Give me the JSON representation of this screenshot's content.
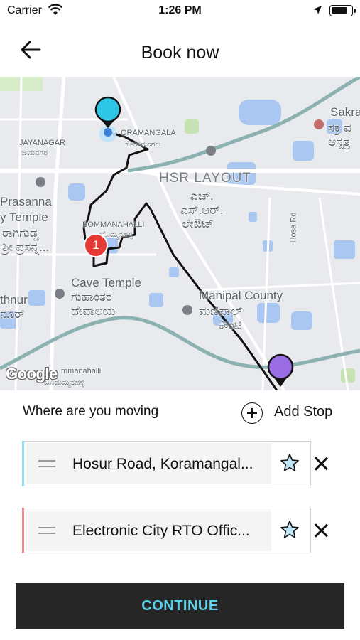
{
  "status_bar": {
    "carrier": "Carrier",
    "time": "1:26 PM"
  },
  "header": {
    "title": "Book now"
  },
  "map": {
    "labels": {
      "sakra": "Sakra",
      "sakra_kn1": "ಸಕ್ರ ವ",
      "sakra_kn2": "ಆಸ್ಪತ್ರ",
      "jayanagar": "JAYANAGAR",
      "jayanagar_kn": "ಜಯನಗರ",
      "koramangala": "ORAMANGALA",
      "koramangala_kn": "ಕೋರಮಂಗಲ",
      "hsr": "HSR LAYOUT",
      "hsr_kn1": "ಎಚ್.",
      "hsr_kn2": "ಎಸ್.ಆರ್.",
      "hsr_kn3": "ಲೇಔಟ್",
      "prasanna": "Prasanna",
      "temple": "y Temple",
      "temple_kn1": "ರಾಗಿಗುಡ್ಡ",
      "temple_kn2": "ಶ್ರೀ ಪ್ರಸನ್ನ...",
      "bommanahalli": "BOMMANAHALLI",
      "bommanahalli_kn": "ಬೊಮ್ಮನಹಳ್ಳಿ",
      "cave": "Cave Temple",
      "cave_kn1": "ಗುಹಾಂತರ",
      "cave_kn2": "ದೇವಾಲಯ",
      "hosa_rd": "Hosa Rd",
      "manipal": "Manipal County",
      "manipal_kn1": "ಮಣಿಪಾಲ್",
      "manipal_kn2": "ಕೌಂಟಿ",
      "thnur": "thnur",
      "thnur_kn": "ನೂರ್",
      "ammanahalli": "mmanahalli",
      "ammanahalli_kn": "ಬೂಡುಮ್ಮನಹಳ್ಳಿ",
      "google": "Google"
    },
    "marker_badge": "1",
    "colors": {
      "pickup": "#2ec6e6",
      "drop": "#9b6de4",
      "stop": "#e53935"
    }
  },
  "booking": {
    "moving_label": "Where are you moving",
    "add_stop": "Add Stop",
    "pickup": {
      "address": "Hosur Road, Koramangal...",
      "accent": "#8fdcee"
    },
    "drop": {
      "address": "Electronic City RTO Offic...",
      "accent": "#f08a8a"
    }
  },
  "continue_label": "CONTINUE"
}
